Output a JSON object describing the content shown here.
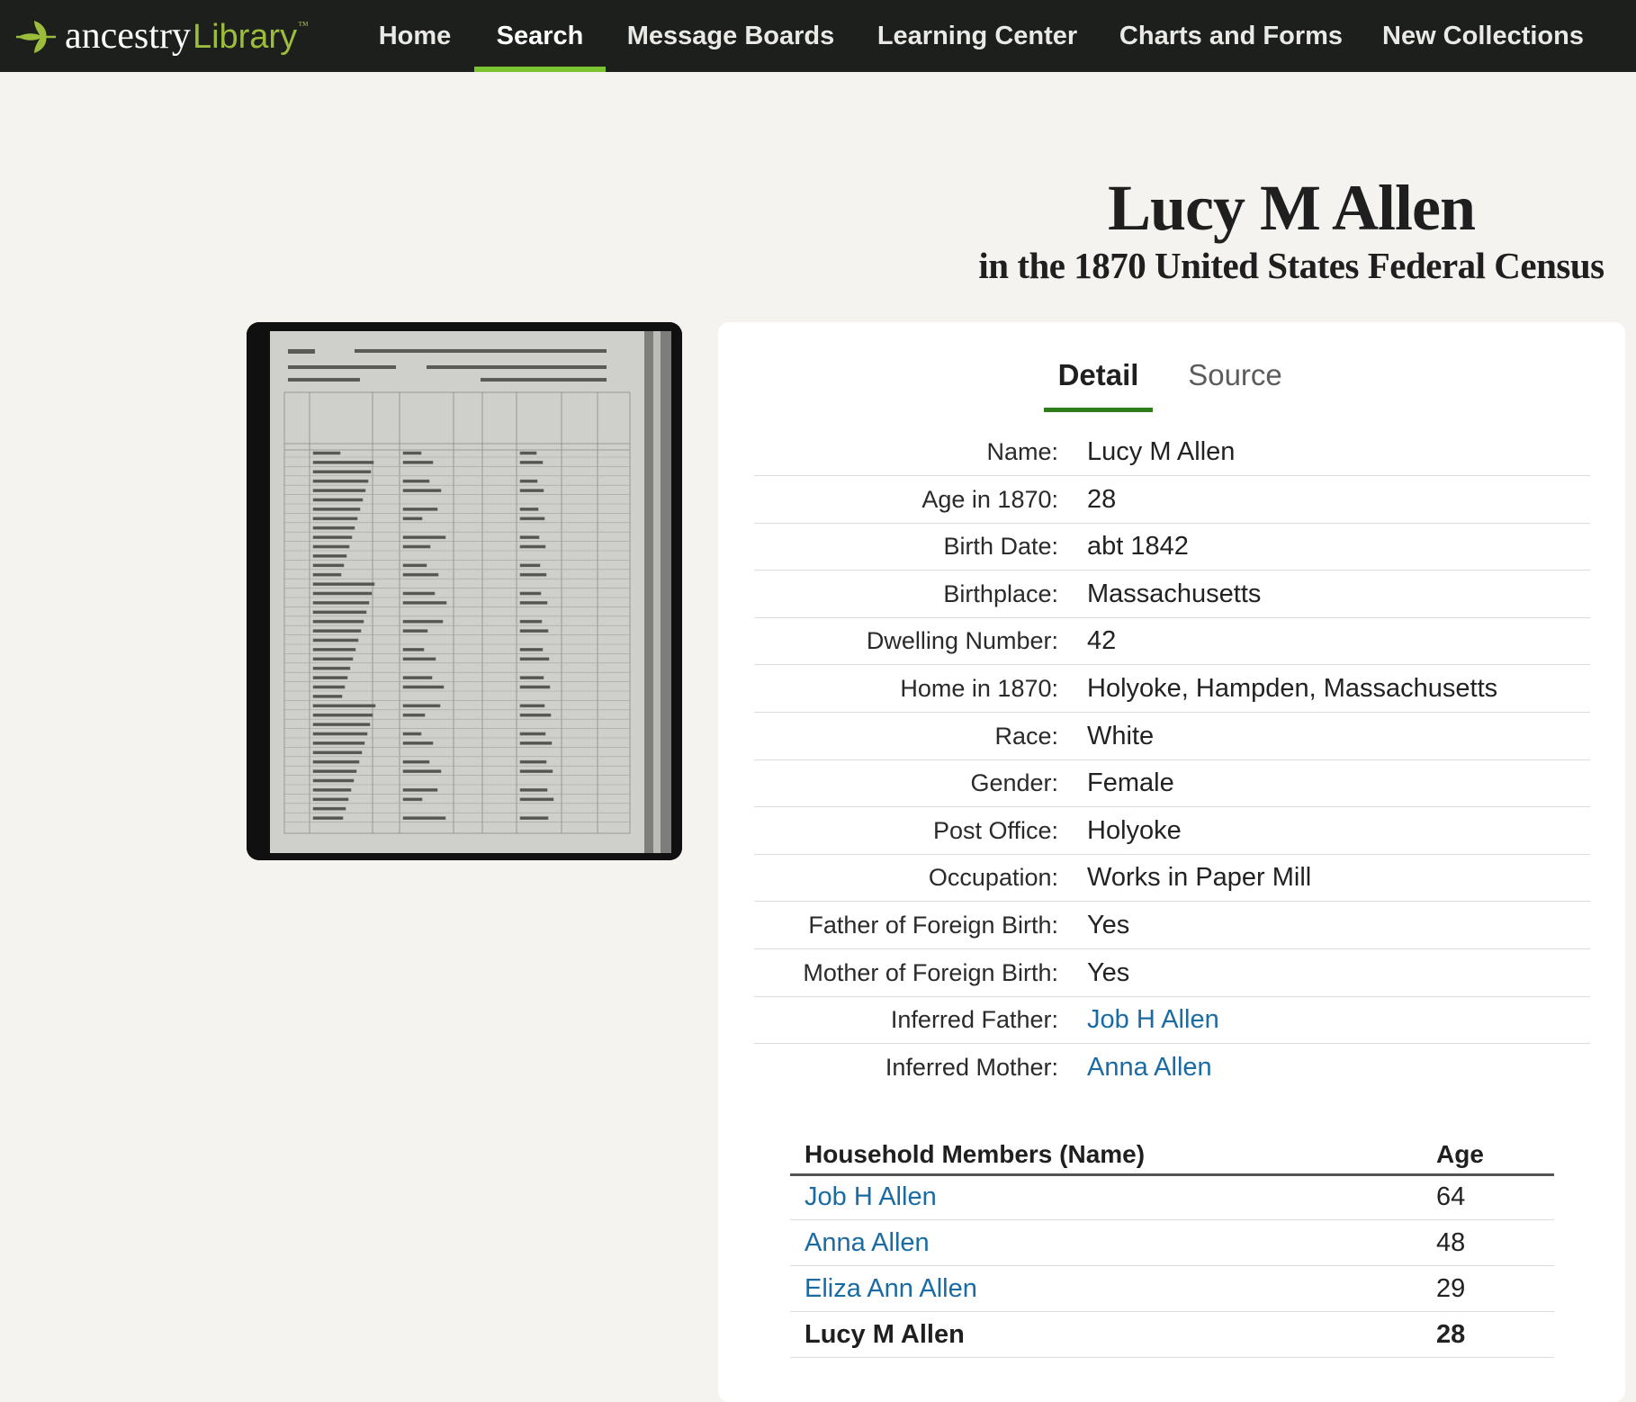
{
  "logo": {
    "ancestry": "ancestry",
    "library": "Library",
    "tm": "™",
    "icon": "ancestry-leaf-icon"
  },
  "nav": {
    "items": [
      {
        "label": "Home"
      },
      {
        "label": "Search",
        "active": true
      },
      {
        "label": "Message Boards"
      },
      {
        "label": "Learning Center"
      },
      {
        "label": "Charts and Forms"
      },
      {
        "label": "New Collections"
      }
    ]
  },
  "heading": {
    "name": "Lucy M Allen",
    "collection": "in the 1870 United States Federal Census"
  },
  "tabs": [
    {
      "label": "Detail",
      "active": true
    },
    {
      "label": "Source"
    }
  ],
  "details": [
    {
      "label": "Name:",
      "value": "Lucy M Allen"
    },
    {
      "label": "Age in 1870:",
      "value": "28"
    },
    {
      "label": "Birth Date:",
      "value": "abt 1842"
    },
    {
      "label": "Birthplace:",
      "value": "Massachusetts"
    },
    {
      "label": "Dwelling Number:",
      "value": "42"
    },
    {
      "label": "Home in 1870:",
      "value": "Holyoke, Hampden, Massachusetts"
    },
    {
      "label": "Race:",
      "value": "White"
    },
    {
      "label": "Gender:",
      "value": "Female"
    },
    {
      "label": "Post Office:",
      "value": "Holyoke"
    },
    {
      "label": "Occupation:",
      "value": "Works in Paper Mill"
    },
    {
      "label": "Father of Foreign Birth:",
      "value": "Yes"
    },
    {
      "label": "Mother of Foreign Birth:",
      "value": "Yes"
    },
    {
      "label": "Inferred Father:",
      "value": "Job H Allen",
      "link": true
    },
    {
      "label": "Inferred Mother:",
      "value": "Anna Allen",
      "link": true
    }
  ],
  "household": {
    "headers": {
      "name": "Household Members (Name)",
      "age": "Age"
    },
    "members": [
      {
        "name": "Job H Allen",
        "age": "64"
      },
      {
        "name": "Anna Allen",
        "age": "48"
      },
      {
        "name": "Eliza Ann Allen",
        "age": "29"
      },
      {
        "name": "Lucy M Allen",
        "age": "28",
        "self": true
      }
    ]
  },
  "colors": {
    "nav_bg": "#1d1f1c",
    "nav_active_underline": "#7cc332",
    "brand_green": "#9cbc3c",
    "tab_underline": "#2e7d1a",
    "link": "#1a6aa3",
    "page_bg": "#f4f3f0"
  }
}
